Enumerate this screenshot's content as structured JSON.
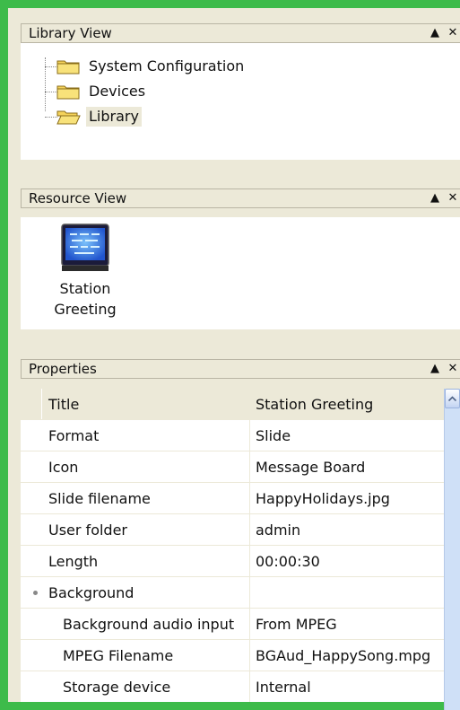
{
  "library_view": {
    "title": "Library View",
    "items": [
      {
        "label": "System Configuration",
        "icon": "folder-icon"
      },
      {
        "label": "Devices",
        "icon": "folder-icon"
      },
      {
        "label": "Library",
        "icon": "open-folder-icon",
        "selected": true
      }
    ]
  },
  "resource_view": {
    "title": "Resource View",
    "items": [
      {
        "label_line1": "Station",
        "label_line2": "Greeting",
        "icon": "message-board-icon"
      }
    ]
  },
  "properties": {
    "title": "Properties",
    "rows": [
      {
        "name": "Title",
        "value": "Station Greeting"
      },
      {
        "name": "Format",
        "value": "Slide"
      },
      {
        "name": "Icon",
        "value": "Message Board"
      },
      {
        "name": "Slide filename",
        "value": "HappyHolidays.jpg"
      },
      {
        "name": "User folder",
        "value": "admin"
      },
      {
        "name": "Length",
        "value": "00:00:30"
      },
      {
        "name": "Background",
        "value": ""
      },
      {
        "name": "Background audio input",
        "value": "From MPEG"
      },
      {
        "name": "MPEG Filename",
        "value": "BGAud_HappySong.mpg"
      },
      {
        "name": "Storage device",
        "value": "Internal"
      }
    ]
  },
  "controls": {
    "collapse_glyph": "▲",
    "close_glyph": "✕"
  },
  "colors": {
    "desktop": "#3dbb4a",
    "panel": "#ece9d8",
    "scrollbar": "#cfe0f7"
  }
}
